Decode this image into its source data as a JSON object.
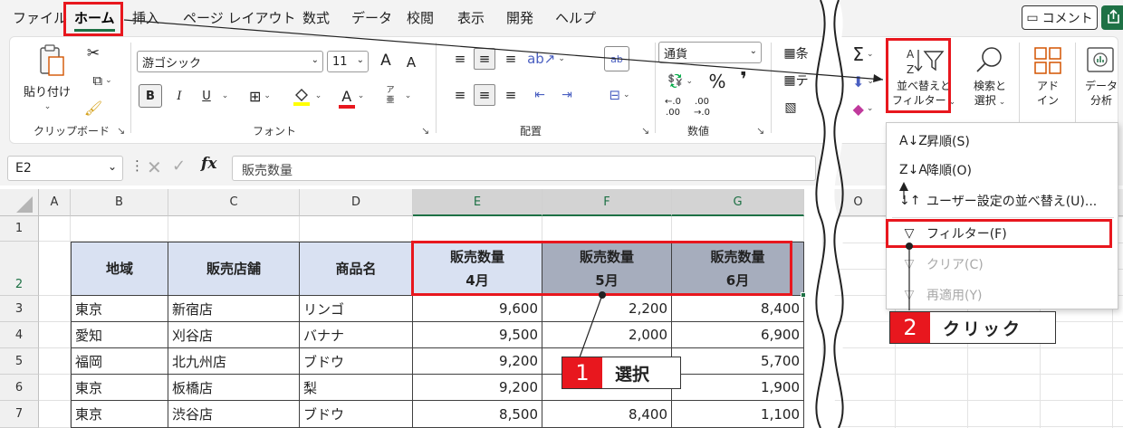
{
  "menu": {
    "tabs": [
      "ファイル",
      "ホーム",
      "挿入",
      "ページ レイアウト",
      "数式",
      "データ",
      "校閲",
      "表示",
      "開発",
      "ヘルプ"
    ],
    "active": "ホーム",
    "comment_label": "コメント"
  },
  "ribbon": {
    "clipboard": {
      "paste_label": "貼り付け",
      "group_label": "クリップボード"
    },
    "font": {
      "font_name": "游ゴシック",
      "font_size": "11",
      "grow": "A",
      "shrink": "A",
      "bold": "B",
      "italic": "I",
      "underline": "U",
      "font_color": "A",
      "phonetic_top": "ア",
      "phonetic_bottom": "亜",
      "group_label": "フォント"
    },
    "alignment": {
      "wrap": "ab",
      "group_label": "配置"
    },
    "number": {
      "format": "通貨",
      "percent": "%",
      "comma": "❜",
      "inc_top": "←.0",
      "inc_bottom": ".00",
      "dec_top": ".00",
      "dec_bottom": "→.0",
      "group_label": "数値"
    },
    "styles": {
      "conditional": "条",
      "table": "テ"
    },
    "editing": {
      "sigma": "Σ",
      "sort_filter_line1": "並べ替えと",
      "sort_filter_line2": "フィルター",
      "find_line1": "検索と",
      "find_line2": "選択"
    },
    "addins": {
      "line1": "アド",
      "line2": "イン"
    },
    "analysis": {
      "line1": "データ",
      "line2": "分析"
    }
  },
  "formula_bar": {
    "cell_ref": "E2",
    "fx": "fx",
    "content": "販売数量"
  },
  "sheet": {
    "columns": [
      "A",
      "B",
      "C",
      "D",
      "E",
      "F",
      "G"
    ],
    "extra_column": "O",
    "rows": [
      "1",
      "2",
      "3",
      "4",
      "5",
      "6",
      "7"
    ],
    "headers": [
      {
        "line1": "地域",
        "line2": ""
      },
      {
        "line1": "販売店舗",
        "line2": ""
      },
      {
        "line1": "商品名",
        "line2": ""
      },
      {
        "line1": "販売数量",
        "line2": "4月"
      },
      {
        "line1": "販売数量",
        "line2": "5月"
      },
      {
        "line1": "販売数量",
        "line2": "6月"
      }
    ],
    "data": [
      [
        "東京",
        "新宿店",
        "リンゴ",
        "9,600",
        "2,200",
        "8,400"
      ],
      [
        "愛知",
        "刈谷店",
        "バナナ",
        "9,500",
        "2,000",
        "6,900"
      ],
      [
        "福岡",
        "北九州店",
        "ブドウ",
        "9,200",
        "",
        "5,700"
      ],
      [
        "東京",
        "板橋店",
        "梨",
        "9,200",
        "",
        "1,900"
      ],
      [
        "東京",
        "渋谷店",
        "ブドウ",
        "8,500",
        "8,400",
        "1,100"
      ]
    ]
  },
  "sort_menu": {
    "items": [
      {
        "icon": "A↓Z",
        "label": "昇順(S)",
        "disabled": false
      },
      {
        "icon": "Z↓A",
        "label": "降順(O)",
        "disabled": false
      },
      {
        "icon": "↓↑",
        "label": "ユーザー設定の並べ替え(U)...",
        "disabled": false
      },
      {
        "icon": "▽",
        "label": "フィルター(F)",
        "disabled": false
      },
      {
        "icon": "▽",
        "label": "クリア(C)",
        "disabled": true
      },
      {
        "icon": "▽",
        "label": "再適用(Y)",
        "disabled": true
      }
    ]
  },
  "callouts": {
    "step1": {
      "number": "1",
      "label": "選択"
    },
    "step2": {
      "number": "2",
      "label": "クリック"
    }
  },
  "colors": {
    "accent_red": "#e8171e",
    "excel_green": "#1e7145",
    "header_fill": "#d9e1f2",
    "header_fill_dark": "#a6adbd"
  }
}
